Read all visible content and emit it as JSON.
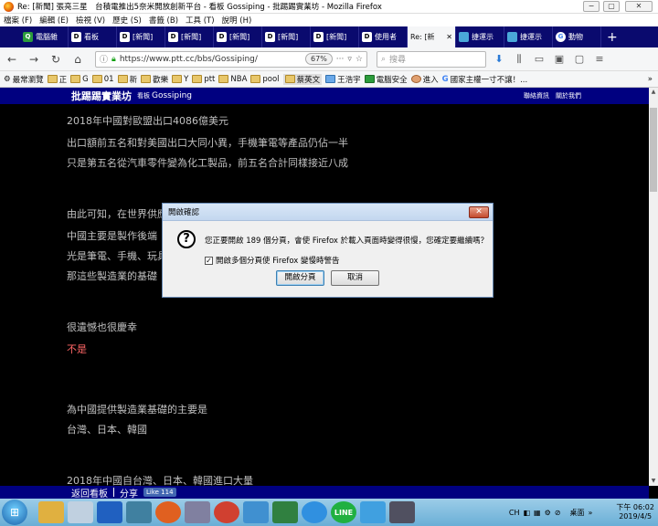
{
  "window": {
    "title": "Re: [新聞] 張亮三星　台積電推出5奈米開放創新平台 - 看板 Gossiping - 批踢踢實業坊 - Mozilla Firefox",
    "min": "−",
    "max": "▢",
    "close": "✕"
  },
  "menu": [
    "檔案 (F)",
    "編輯 (E)",
    "檢視 (V)",
    "歷史 (S)",
    "書籤 (B)",
    "工具 (T)",
    "說明 (H)"
  ],
  "tabs": [
    {
      "icon": "Q",
      "label": "電腦雜",
      "active": false
    },
    {
      "icon": "D",
      "label": "看板",
      "active": false
    },
    {
      "icon": "D",
      "label": "[新聞]",
      "active": false
    },
    {
      "icon": "D",
      "label": "[新聞]",
      "active": false
    },
    {
      "icon": "D",
      "label": "[新聞]",
      "active": false
    },
    {
      "icon": "D",
      "label": "[新聞]",
      "active": false
    },
    {
      "icon": "D",
      "label": "[新聞]",
      "active": false
    },
    {
      "icon": "D",
      "label": "使用者",
      "active": false
    },
    {
      "icon": "",
      "label": "Re: [新",
      "active": true
    },
    {
      "icon": "",
      "label": "捷運示",
      "active": false
    },
    {
      "icon": "",
      "label": "捷運示",
      "active": false
    },
    {
      "icon": "G",
      "label": "動物",
      "active": false
    }
  ],
  "newtab": "+",
  "nav": {
    "url": "https://www.ptt.cc/bbs/Gossiping/",
    "zoom": "67%",
    "search_placeholder": "搜尋"
  },
  "bookmarks": [
    "最常瀏覽",
    "正",
    "G",
    "01",
    "新",
    "歡樂",
    "Y",
    "ptt",
    "NBA",
    "pool",
    "蔡英文",
    "王浩宇",
    "電腦安全",
    "進入",
    "國家主權一寸不讓！..."
  ],
  "ptt": {
    "brand": "批踢踢實業坊",
    "board_prefix": "看板",
    "board": "Gossiping",
    "header_links": "聯絡資訊　關於我們",
    "back": "返回看板",
    "share": "分享",
    "fb_like": "Like 114"
  },
  "content_lines": [
    {
      "text": "2018年中國對歐盟出口4086億美元",
      "red": false
    },
    {
      "text": "出口額前五名和對美國出口大同小異，手機筆電等產品仍佔一半",
      "red": false
    },
    {
      "text": "只是第五名從汽車零件變為化工製品，前五名合計同樣接近八成",
      "red": false
    },
    {
      "text": "由此可知，在世界供應",
      "red": false
    },
    {
      "text": "中國主要是製作後端",
      "red": false
    },
    {
      "text": "光是筆電、手機、玩具",
      "red": false
    },
    {
      "text": "那這些製造業的基礎",
      "red": false
    },
    {
      "text": "很遺憾也很慶幸",
      "red": false
    },
    {
      "text": "不是",
      "red": true
    },
    {
      "text": "為中國提供製造業基礎的主要是",
      "red": false
    },
    {
      "text": "台灣、日本、韓國",
      "red": false
    },
    {
      "text": "2018年中國自台灣、日本、韓國進口大量",
      "red": false
    }
  ],
  "dialog": {
    "title": "開啟確認",
    "message": "您正要開啟 189 個分頁，會使 Firefox 於載入頁面時變得很慢，您確定要繼續嗎？",
    "checkbox_label": "開啟多個分頁使 Firefox 變慢時警告",
    "checkbox_checked": "✓",
    "ok": "開啟分頁",
    "cancel": "取消",
    "close": "✕"
  },
  "taskbar": {
    "start": "⊞",
    "apps": [
      {
        "label": "",
        "color": "#e0b040"
      },
      {
        "label": "",
        "color": "#c0d0e0"
      },
      {
        "label": "",
        "color": "#2060c0"
      },
      {
        "label": "",
        "color": "#4080a0"
      },
      {
        "label": "",
        "color": "#e06020"
      },
      {
        "label": "",
        "color": "#8080a0"
      },
      {
        "label": "",
        "color": "#d04030"
      },
      {
        "label": "",
        "color": "#4090d0"
      },
      {
        "label": "",
        "color": "#308040"
      },
      {
        "label": "",
        "color": "#3090e0"
      },
      {
        "label": "LINE",
        "color": "#20b040"
      },
      {
        "label": "",
        "color": "#40a0e0"
      },
      {
        "label": "",
        "color": "#505060"
      }
    ],
    "tray_lang": "CH",
    "desktop": "桌面",
    "time": "下午 06:02",
    "date": "2019/4/5"
  },
  "colors": {
    "tabbar": "#0a0a6e",
    "ptt_blue": "#000080",
    "text": "#c0c0c0",
    "red_text": "#ff6666"
  }
}
